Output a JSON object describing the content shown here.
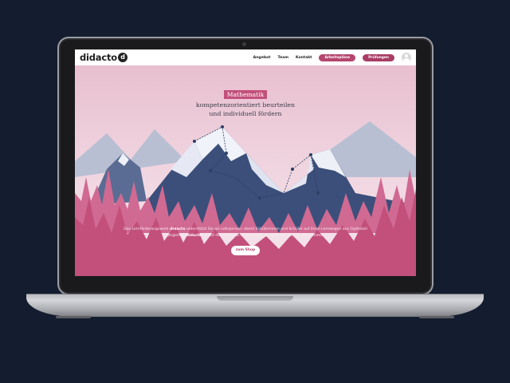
{
  "nav": {
    "logo": "didacto",
    "logo_mark": "d",
    "links": [
      "Angebot",
      "Team",
      "Kontakt"
    ],
    "primary_button": "Arbeitspläne",
    "secondary_button": "Prüfungen",
    "user_icon": "user-icon"
  },
  "hero": {
    "tag": "Mathematik",
    "line1": "kompetenzorientiert beurteilen",
    "line2": "und individuell fördern",
    "intro_part1": "Das Lernförderungswerk",
    "intro_brand1": "didacto",
    "intro_part2": "unterstützt Sie als Lehrperson, damit Schülerinnen und Schüler auf ihren Lernwegen ans Gipfelziel",
    "intro_part3": "begleitet",
    "intro_brand2": "didacto",
    "intro_part4": "ist auf den Lehrplan Mathematik des Kantons Zürich abgestimmt.",
    "shop_button": "zum Shop"
  },
  "colors": {
    "brand": "#b4456e",
    "forest": "#c2507a",
    "sky": "#efd3de",
    "mountain": "#3b4f7a",
    "snow": "#f4f5fb",
    "background": "#141c2f"
  }
}
